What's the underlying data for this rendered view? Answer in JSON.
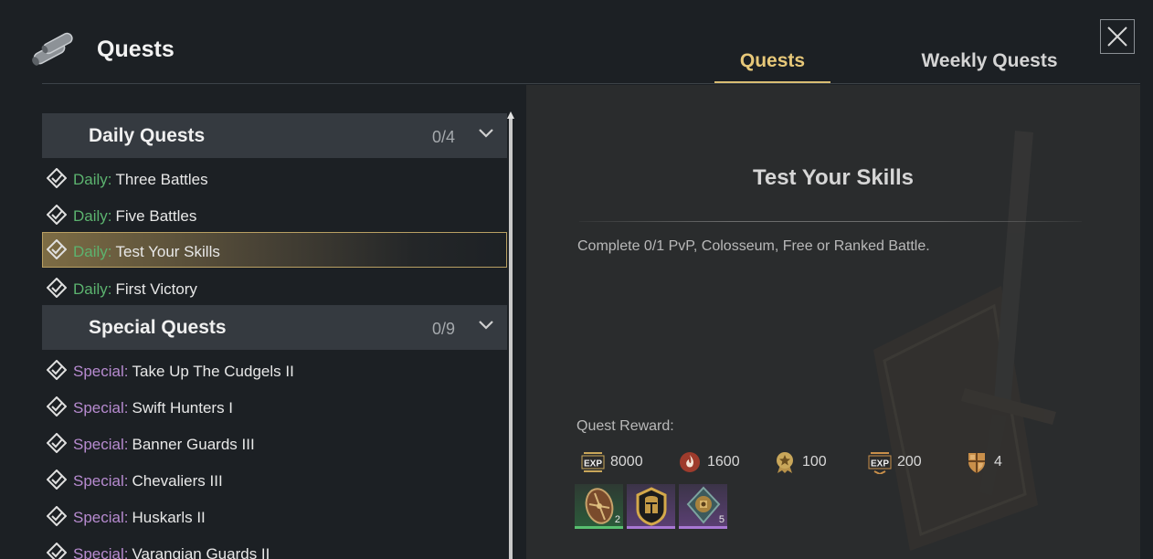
{
  "header": {
    "title": "Quests",
    "icon": "scroll-icon",
    "close_icon": "close-icon"
  },
  "tabs": [
    {
      "label": "Quests",
      "active": true
    },
    {
      "label": "Weekly Quests",
      "active": false
    }
  ],
  "groups": {
    "daily": {
      "title": "Daily Quests",
      "count": "0/4",
      "items": [
        {
          "prefix": "Daily:",
          "name": "Three Battles"
        },
        {
          "prefix": "Daily:",
          "name": "Five Battles"
        },
        {
          "prefix": "Daily:",
          "name": "Test Your Skills",
          "selected": true
        },
        {
          "prefix": "Daily:",
          "name": "First Victory"
        }
      ]
    },
    "special": {
      "title": "Special Quests",
      "count": "0/9",
      "items": [
        {
          "prefix": "Special:",
          "name": "Take Up The Cudgels II"
        },
        {
          "prefix": "Special:",
          "name": "Swift Hunters I"
        },
        {
          "prefix": "Special:",
          "name": "Banner Guards III"
        },
        {
          "prefix": "Special:",
          "name": "Chevaliers III"
        },
        {
          "prefix": "Special:",
          "name": "Huskarls II"
        },
        {
          "prefix": "Special:",
          "name": "Varangian Guards II"
        }
      ]
    }
  },
  "detail": {
    "title": "Test Your Skills",
    "description": "Complete 0/1 PvP, Colosseum, Free or Ranked Battle.",
    "reward_label": "Quest Reward:",
    "rewards": [
      {
        "icon": "exp-icon",
        "value": "8000"
      },
      {
        "icon": "flame-icon",
        "value": "1600"
      },
      {
        "icon": "medal-icon",
        "value": "100"
      },
      {
        "icon": "unit-exp-icon",
        "value": "200"
      },
      {
        "icon": "shield-badge-icon",
        "value": "4"
      }
    ],
    "items": [
      {
        "icon": "shield-item-icon",
        "rarity": "green",
        "count": "2"
      },
      {
        "icon": "helmet-item-icon",
        "rarity": "purple",
        "count": ""
      },
      {
        "icon": "trinket-item-icon",
        "rarity": "purple",
        "count": "5"
      }
    ]
  },
  "colors": {
    "accent_gold": "#e7c879",
    "daily_green": "#5cb36f",
    "special_purple": "#b78bd0",
    "rare_green": "#58c070",
    "epic_purple": "#a877d4"
  }
}
